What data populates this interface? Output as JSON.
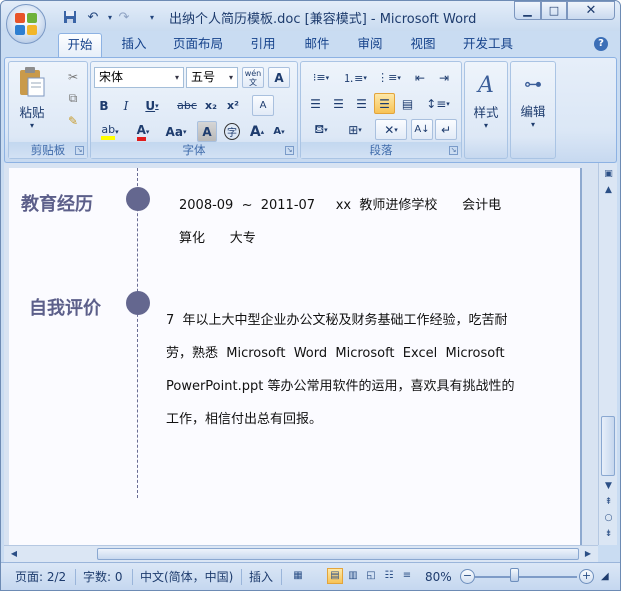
{
  "window": {
    "title": "出纳个人简历模板.doc [兼容模式] - Microsoft Word",
    "minimize_icon": "minimize-icon",
    "maximize_icon": "maximize-icon",
    "close_icon": "close-icon"
  },
  "quick_access": [
    "save-icon",
    "undo-icon",
    "redo-icon",
    "customize-icon"
  ],
  "tabs": [
    {
      "label": "开始",
      "active": true
    },
    {
      "label": "插入"
    },
    {
      "label": "页面布局"
    },
    {
      "label": "引用"
    },
    {
      "label": "邮件"
    },
    {
      "label": "审阅"
    },
    {
      "label": "视图"
    },
    {
      "label": "开发工具"
    }
  ],
  "ribbon": {
    "clipboard": {
      "label": "剪贴板",
      "paste_label": "粘贴"
    },
    "font": {
      "label": "字体",
      "font_name": "宋体",
      "font_size": "五号",
      "bold": "B",
      "italic": "I",
      "underline": "U",
      "strike": "abc",
      "subscript": "x₂",
      "superscript": "x²",
      "change_case": "Aa",
      "grow": "A",
      "shrink": "A",
      "char_border": "A",
      "enclose": "字",
      "phonetic": "wén 文",
      "clear_format": "A"
    },
    "paragraph": {
      "label": "段落"
    },
    "styles": {
      "label": "样式"
    },
    "editing": {
      "label": "编辑"
    }
  },
  "document": {
    "education": {
      "title": "教育经历",
      "line1": "2008-09  ~  2011-07     xx  教师进修学校      会计电",
      "line2": "算化      大专"
    },
    "self_eval": {
      "title": "自我评价",
      "line1": "7  年以上大中型企业办公文秘及财务基础工作经验，吃苦耐",
      "line2": "劳，熟悉  Microsoft  Word  Microsoft  Excel  Microsoft",
      "line3": "PowerPoint.ppt 等办公常用软件的运用，喜欢具有挑战性的",
      "line4": "工作，相信付出总有回报。"
    }
  },
  "status": {
    "page": "页面: 2/2",
    "words": "字数: 0",
    "language": "中文(简体，中国)",
    "insert_mode": "插入",
    "zoom": "80%"
  }
}
